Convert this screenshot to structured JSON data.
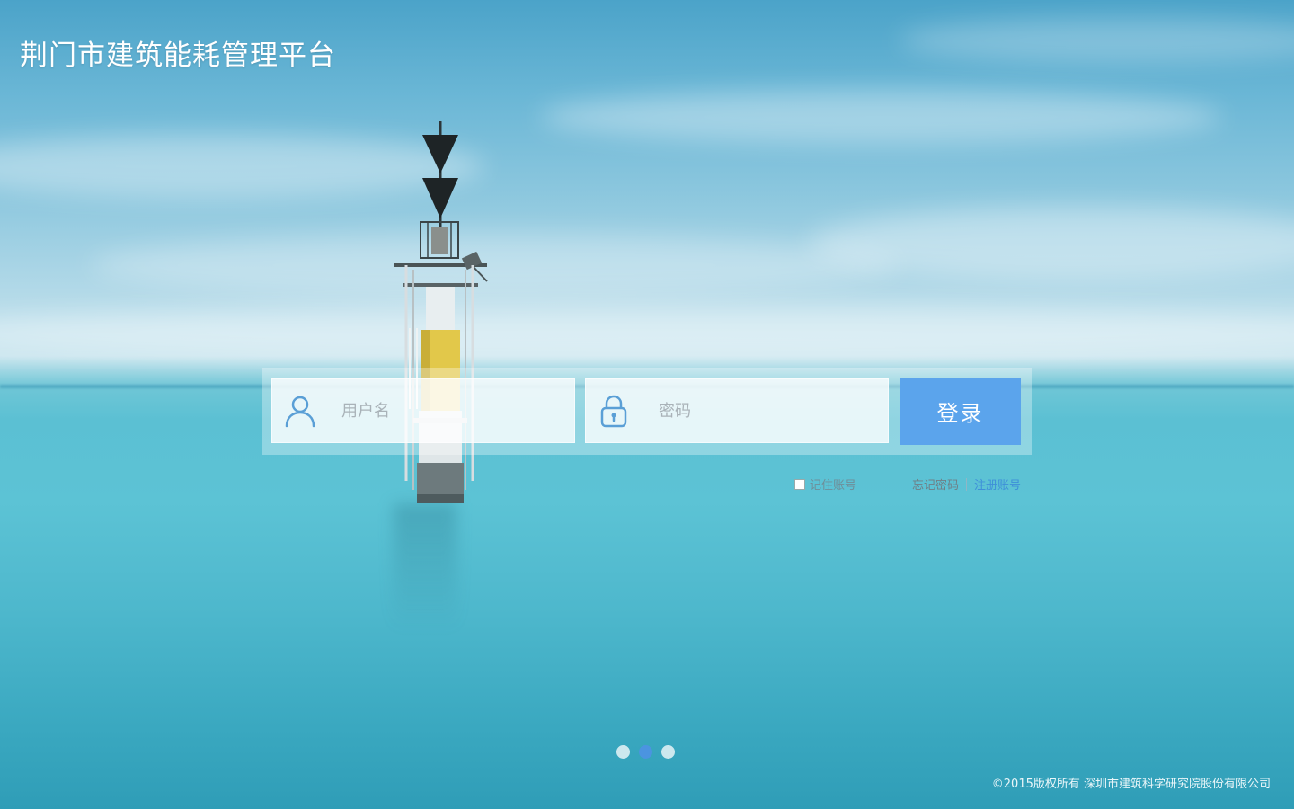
{
  "header": {
    "title": "荆门市建筑能耗管理平台"
  },
  "login": {
    "username_placeholder": "用户名",
    "password_placeholder": "密码",
    "username_icon": "user-icon",
    "password_icon": "lock-icon",
    "submit_label": "登录",
    "remember_label": "记住账号",
    "forgot_label": "忘记密码",
    "register_label": "注册账号"
  },
  "carousel": {
    "count": 3,
    "active_index": 1
  },
  "footer": {
    "copyright": "©2015版权所有 深圳市建筑科学研究院股份有限公司"
  },
  "colors": {
    "accent": "#5ba4ec",
    "link": "#3e8fd9",
    "icon": "#5a9fd6"
  }
}
